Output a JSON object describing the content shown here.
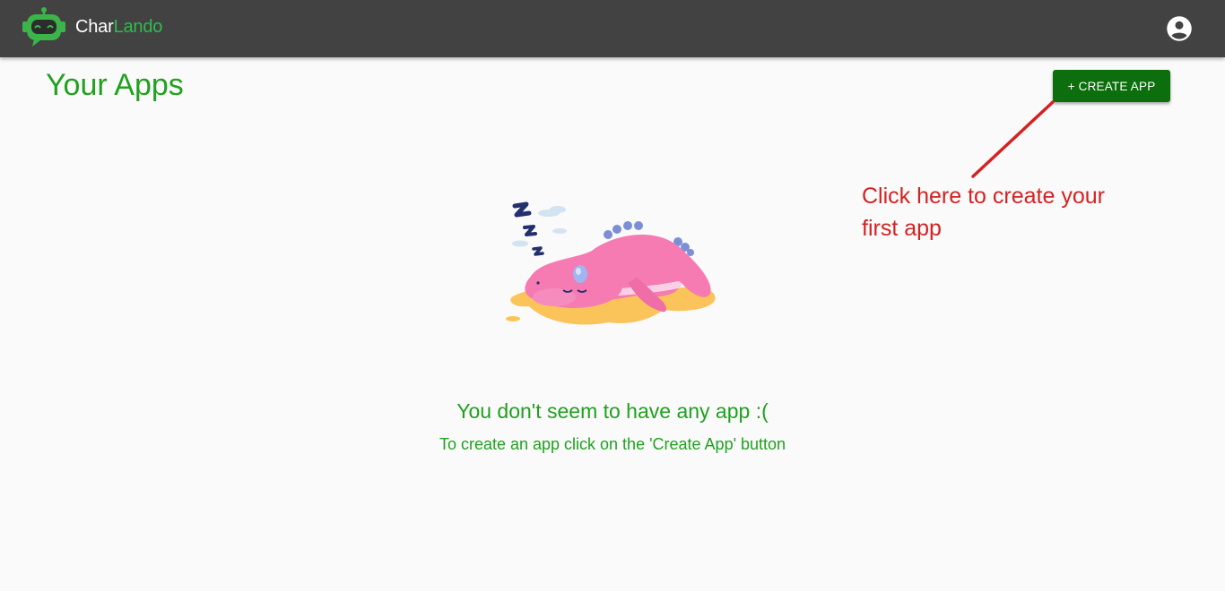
{
  "header": {
    "brand_part1": "Char",
    "brand_part2": "Lando",
    "logo_icon": "robot-icon",
    "account_icon": "account-circle-icon"
  },
  "main": {
    "title": "Your Apps",
    "create_button_label": "+ CREATE APP",
    "annotation": "Click here to create your first app",
    "empty_state": {
      "illustration": "sleeping-dinosaur",
      "title": "You don't seem to have any app :(",
      "subtitle": "To create an app click on the 'Create App' button"
    }
  },
  "colors": {
    "appbar": "#424242",
    "brand_green": "#2ebd4a",
    "title_green": "#21a11f",
    "button_green": "#0d6e0d",
    "annotation_red": "#d42222",
    "background": "#fafafa"
  }
}
